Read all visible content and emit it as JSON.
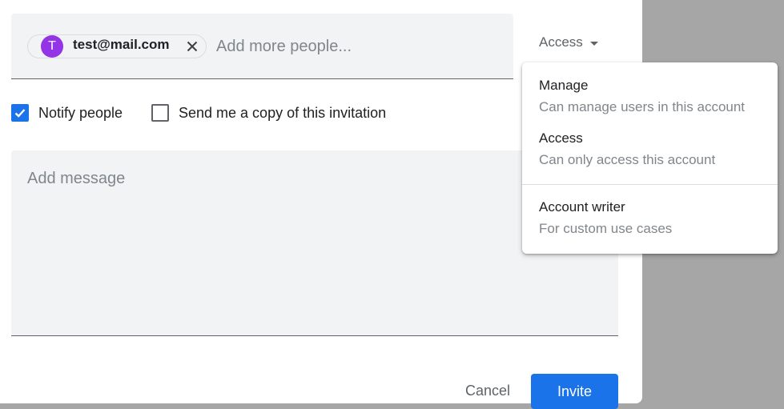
{
  "recipients": {
    "chips": [
      {
        "avatar_letter": "T",
        "email": "test@mail.com",
        "avatar_color": "#9334e6"
      }
    ],
    "placeholder": "Add more people..."
  },
  "access_dropdown": {
    "selected": "Access"
  },
  "options": {
    "notify": {
      "label": "Notify people",
      "checked": true
    },
    "send_copy": {
      "label": "Send me a copy of this invitation",
      "checked": false
    }
  },
  "message": {
    "placeholder": "Add message"
  },
  "actions": {
    "cancel_label": "Cancel",
    "invite_label": "Invite"
  },
  "menu": {
    "items": [
      {
        "title": "Manage",
        "description": "Can manage users in this account"
      },
      {
        "title": "Access",
        "description": "Can only access this account"
      },
      {
        "title": "Account writer",
        "description": "For custom use cases"
      }
    ]
  },
  "colors": {
    "accent": "#1a73e8",
    "avatar": "#9334e6",
    "field_background": "#f1f3f4",
    "overlay": "#a6a6a6"
  }
}
